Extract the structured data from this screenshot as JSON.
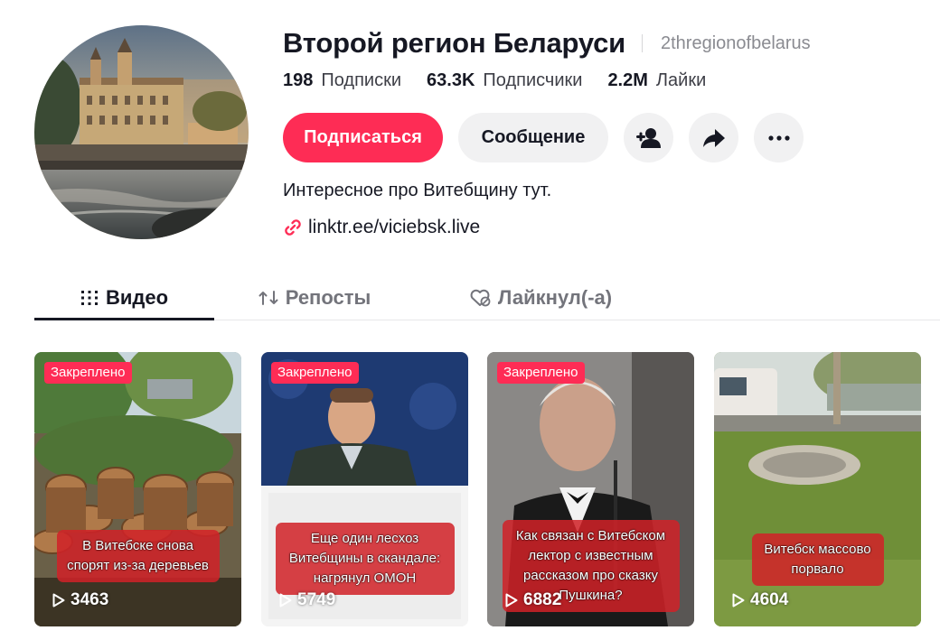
{
  "profile": {
    "display_name": "Второй регион Беларуси",
    "username": "2thregionofbelarus",
    "bio": "Интересное про Витебщину тут.",
    "link": "linktr.ee/viciebsk.live"
  },
  "stats": [
    {
      "value": "198",
      "label": "Подписки"
    },
    {
      "value": "63.3K",
      "label": "Подписчики"
    },
    {
      "value": "2.2M",
      "label": "Лайки"
    }
  ],
  "actions": {
    "follow_label": "Подписаться",
    "message_label": "Сообщение",
    "icons": [
      "add-friend-icon",
      "share-icon",
      "more-icon"
    ]
  },
  "tabs": [
    {
      "label": "Видео",
      "icon": "grid-icon",
      "active": true
    },
    {
      "label": "Репосты",
      "icon": "repost-icon",
      "active": false
    },
    {
      "label": "Лайкнул(-а)",
      "icon": "liked-hidden-icon",
      "active": false
    }
  ],
  "videos": [
    {
      "pinned_label": "Закреплено",
      "caption_lines": [
        "В Витебске снова",
        "спорят из-за деревьев"
      ],
      "views": "3463",
      "thumbnail": "cut tree stumps in park"
    },
    {
      "pinned_label": "Закреплено",
      "caption_lines": [
        "Еще один лесхоз",
        "Витебщины в скандале:",
        "нагрянул ОМОН"
      ],
      "views": "5749",
      "thumbnail": "official in uniform at press briefing"
    },
    {
      "pinned_label": "Закреплено",
      "caption_lines": [
        "Как связан с Витебском",
        "лектор с известным",
        "рассказом про сказку",
        "Пушкина?"
      ],
      "views": "6882",
      "thumbnail": "man speaking at microphone"
    },
    {
      "pinned_label": "",
      "caption_lines": [
        "Витебск массово",
        "порвало"
      ],
      "views": "4604",
      "thumbnail": "burst pipe on grass lawn"
    }
  ],
  "colors": {
    "accent": "#fe2c55",
    "text_primary": "#161823",
    "text_secondary": "#8a8b91",
    "button_gray": "#f1f1f2",
    "caption_red": "#d12228"
  }
}
